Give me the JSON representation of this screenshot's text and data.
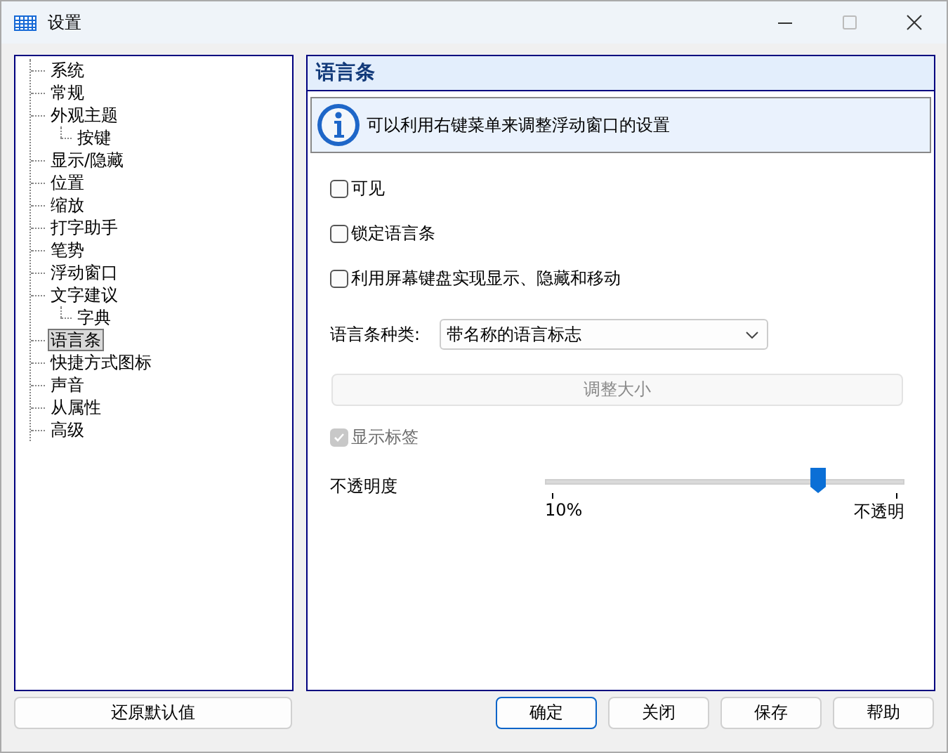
{
  "window": {
    "title": "设置"
  },
  "tree": [
    {
      "label": "系统",
      "selected": false
    },
    {
      "label": "常规",
      "selected": false
    },
    {
      "label": "外观主题",
      "selected": false,
      "children": [
        {
          "label": "按键",
          "selected": false
        }
      ]
    },
    {
      "label": "显示/隐藏",
      "selected": false
    },
    {
      "label": "位置",
      "selected": false
    },
    {
      "label": "缩放",
      "selected": false
    },
    {
      "label": "打字助手",
      "selected": false
    },
    {
      "label": "笔势",
      "selected": false
    },
    {
      "label": "浮动窗口",
      "selected": false
    },
    {
      "label": "文字建议",
      "selected": false,
      "children": [
        {
          "label": "字典",
          "selected": false
        }
      ]
    },
    {
      "label": "语言条",
      "selected": true
    },
    {
      "label": "快捷方式图标",
      "selected": false
    },
    {
      "label": "声音",
      "selected": false
    },
    {
      "label": "从属性",
      "selected": false
    },
    {
      "label": "高级",
      "selected": false
    }
  ],
  "panel": {
    "title": "语言条",
    "info": "可以利用右键菜单来调整浮动窗口的设置",
    "controls": [
      {
        "kind": "checkbox",
        "label": "可见",
        "checked": false,
        "disabled": false
      },
      {
        "kind": "checkbox",
        "label": "锁定语言条",
        "checked": false,
        "disabled": false
      },
      {
        "kind": "checkbox",
        "label": "利用屏幕键盘实现显示、隐藏和移动",
        "checked": false,
        "disabled": false
      },
      {
        "kind": "dropdown",
        "label": "语言条种类:",
        "value": "带名称的语言标志"
      },
      {
        "kind": "button",
        "label": "调整大小",
        "disabled": true
      },
      {
        "kind": "checkbox",
        "label": "显示标签",
        "checked": true,
        "disabled": true
      },
      {
        "kind": "slider",
        "label": "不透明度",
        "level": 0.76,
        "min_label": "10%",
        "max_label": "不透明"
      }
    ]
  },
  "buttons": [
    {
      "label": "还原默认值",
      "default": false
    },
    {
      "label": "确定",
      "default": true
    },
    {
      "label": "关闭",
      "default": false
    },
    {
      "label": "保存",
      "default": false
    },
    {
      "label": "帮助",
      "default": false
    }
  ]
}
